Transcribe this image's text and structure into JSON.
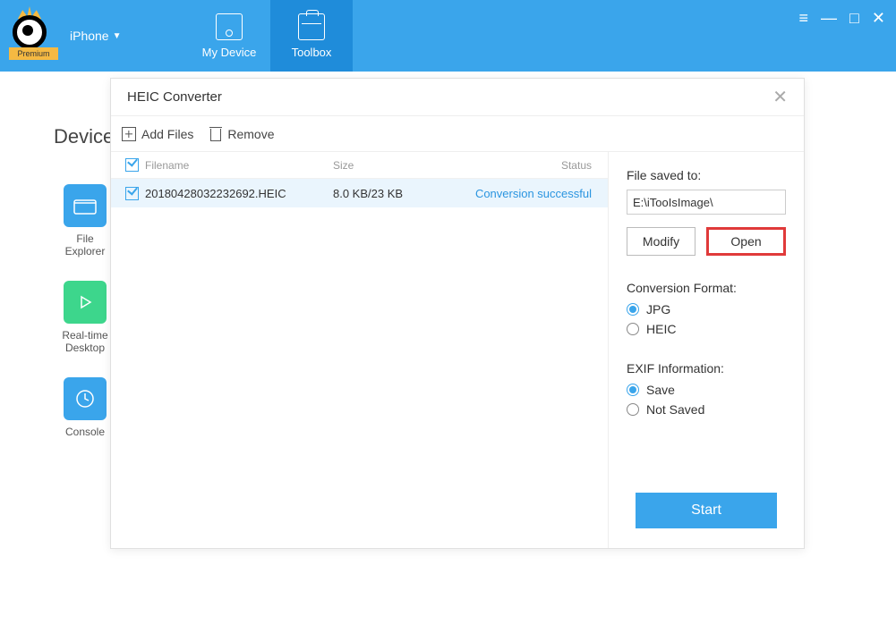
{
  "header": {
    "device_label": "iPhone",
    "premium_badge": "Premium",
    "tabs": {
      "my_device": "My Device",
      "toolbox": "Toolbox"
    }
  },
  "bg": {
    "section_title": "Device",
    "tiles": {
      "file_explorer": "File\nExplorer",
      "realtime_desktop": "Real-time\nDesktop",
      "console": "Console"
    }
  },
  "modal": {
    "title": "HEIC Converter",
    "toolbar": {
      "add_files": "Add Files",
      "remove": "Remove"
    },
    "columns": {
      "filename": "Filename",
      "size": "Size",
      "status": "Status"
    },
    "rows": [
      {
        "filename": "20180428032232692.HEIC",
        "size": "8.0 KB/23 KB",
        "status": "Conversion successful",
        "checked": true
      }
    ],
    "side": {
      "saved_to_label": "File saved to:",
      "saved_to_path": "E:\\iTooIsImage\\",
      "modify": "Modify",
      "open": "Open",
      "format_label": "Conversion Format:",
      "format_jpg": "JPG",
      "format_heic": "HEIC",
      "exif_label": "EXIF Information:",
      "exif_save": "Save",
      "exif_notsaved": "Not Saved",
      "start": "Start"
    }
  }
}
